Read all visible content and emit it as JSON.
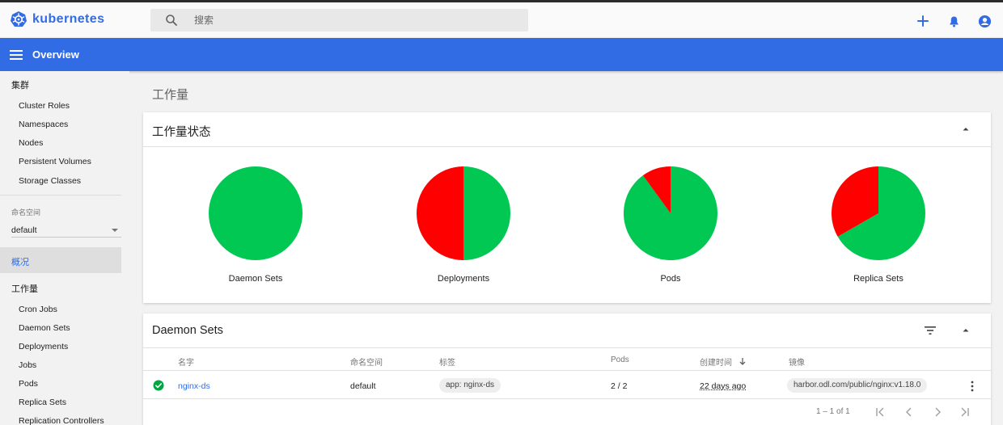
{
  "topbar": {
    "brand": "kubernetes",
    "search_placeholder": "搜索",
    "icons": [
      "add-icon",
      "notifications-bell-icon",
      "account-circle-icon"
    ]
  },
  "header": {
    "title": "Overview"
  },
  "sidebar": {
    "cluster_heading": "集群",
    "cluster_items": [
      "Cluster Roles",
      "Namespaces",
      "Nodes",
      "Persistent Volumes",
      "Storage Classes"
    ],
    "namespace_label": "命名空间",
    "namespace_value": "default",
    "overview_label": "概况",
    "workloads_heading": "工作量",
    "workload_items": [
      "Cron Jobs",
      "Daemon Sets",
      "Deployments",
      "Jobs",
      "Pods",
      "Replica Sets",
      "Replication Controllers"
    ]
  },
  "main": {
    "page_title": "工作量",
    "status_card": {
      "title": "工作量状态",
      "charts": [
        {
          "label": "Daemon Sets",
          "green_fraction": 1.0
        },
        {
          "label": "Deployments",
          "green_fraction": 0.5
        },
        {
          "label": "Pods",
          "green_fraction": 0.9
        },
        {
          "label": "Replica Sets",
          "green_fraction": 0.667
        }
      ]
    },
    "daemon_sets_card": {
      "title": "Daemon Sets",
      "columns": {
        "name": "名字",
        "namespace": "命名空间",
        "labels": "标签",
        "pods": "Pods",
        "created": "创建时间",
        "images": "镜像"
      },
      "rows": [
        {
          "name": "nginx-ds",
          "namespace": "default",
          "label": "app: nginx-ds",
          "pods": "2 / 2",
          "age": "22 days ago",
          "image": "harbor.odl.com/public/nginx:v1.18.0"
        }
      ],
      "pagination": "1 – 1 of 1"
    }
  },
  "colors": {
    "brand_blue": "#326ce5",
    "pie_green": "#00c853",
    "pie_red": "#ff0000"
  }
}
